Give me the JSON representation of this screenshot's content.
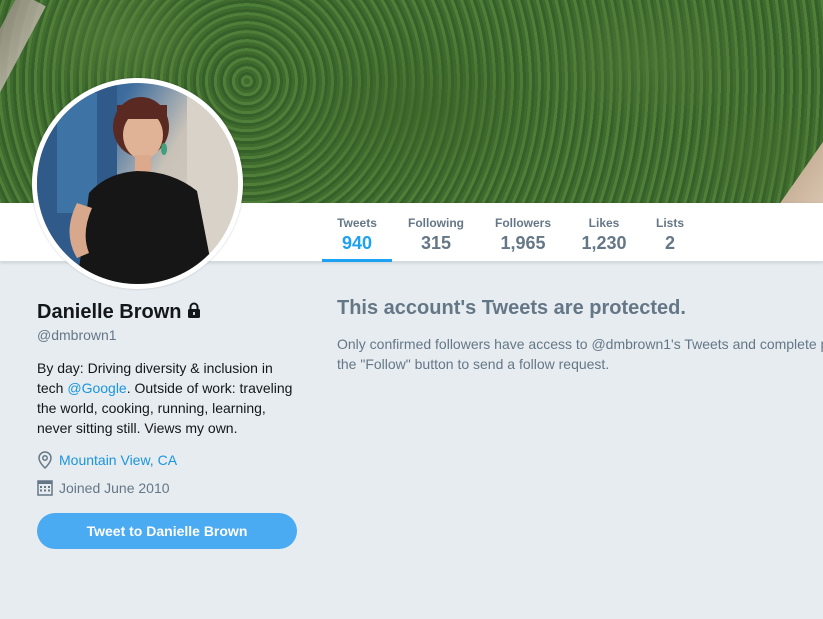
{
  "profile": {
    "name": "Danielle Brown",
    "handle": "@dmbrown1",
    "bio_pre": "By day: Driving diversity & inclusion in tech ",
    "bio_link": "@Google",
    "bio_post": ". Outside of work: traveling the world, cooking, running, learning, never sitting still. Views my own.",
    "location": "Mountain View, CA",
    "joined": "Joined June 2010",
    "tweet_button": "Tweet to Danielle Brown"
  },
  "nav": [
    {
      "label": "Tweets",
      "value": "940"
    },
    {
      "label": "Following",
      "value": "315"
    },
    {
      "label": "Followers",
      "value": "1,965"
    },
    {
      "label": "Likes",
      "value": "1,230"
    },
    {
      "label": "Lists",
      "value": "2"
    }
  ],
  "protected": {
    "title": "This account's Tweets are protected.",
    "line1": "Only confirmed followers have access to @dmbrown1's Tweets and complete p",
    "line2": "the \"Follow\" button to send a follow request."
  },
  "colors": {
    "accent": "#1da1f2",
    "link": "#1b95e0",
    "button": "#4aaaf2",
    "background": "#e6ecf0",
    "muted": "#657786"
  },
  "icons": {
    "lock": "lock-icon",
    "location": "location-pin-icon",
    "calendar": "calendar-icon"
  }
}
